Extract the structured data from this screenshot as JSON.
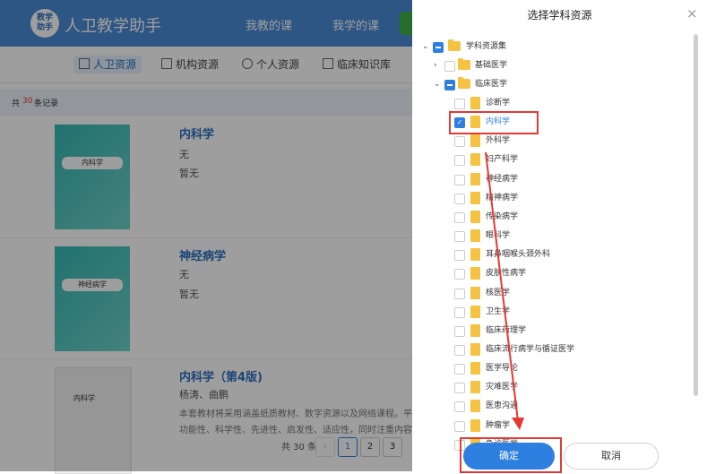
{
  "app": {
    "logo_text": "教学\n助手",
    "title": "人卫教学助手",
    "nav_teach": "我教的课",
    "nav_learn": "我学的课"
  },
  "subnav": {
    "tab_renwei": "人卫资源",
    "tab_org": "机构资源",
    "tab_personal": "个人资源",
    "tab_clinical": "临床知识库"
  },
  "records": {
    "prefix": "共",
    "count": "30",
    "suffix": "条记录"
  },
  "books": [
    {
      "title": "内科学",
      "line1": "无",
      "line2": "暂无",
      "cover_label": "内科学"
    },
    {
      "title": "神经病学",
      "line1": "无",
      "line2": "暂无",
      "cover_label": "神经病学"
    },
    {
      "title": "内科学（第4版)",
      "line1": "杨涛、曲鹏",
      "cover_label": "内科学",
      "desc": "本套教材将采用涵盖纸质教材、数字资源以及网络课程。平台功能性、科学性、先进性、启发性、适应性，同时注重内容安排合理，"
    }
  ],
  "pager": {
    "total": "共 30 条",
    "prev": "‹",
    "p1": "1",
    "p2": "2",
    "p3": "3"
  },
  "modal": {
    "title": "选择学科资源",
    "close": "×",
    "root": "学科资源集",
    "node_basic": "基础医学",
    "node_clinical": "临床医学",
    "items": [
      "诊断学",
      "内科学",
      "外科学",
      "妇产科学",
      "神经病学",
      "精神病学",
      "传染病学",
      "眼科学",
      "耳鼻咽喉头颈外科",
      "皮肤性病学",
      "核医学",
      "卫生学",
      "临床药理学",
      "临床流行病学与循证医学",
      "医学导论",
      "灾难医学",
      "医患沟通",
      "肿瘤学",
      "急诊医学"
    ],
    "ok": "确定",
    "cancel": "取消"
  },
  "colors": {
    "primary": "#2d7fe0",
    "header": "#4a8bd6",
    "annotation": "#e53935",
    "folder": "#f5c242"
  }
}
